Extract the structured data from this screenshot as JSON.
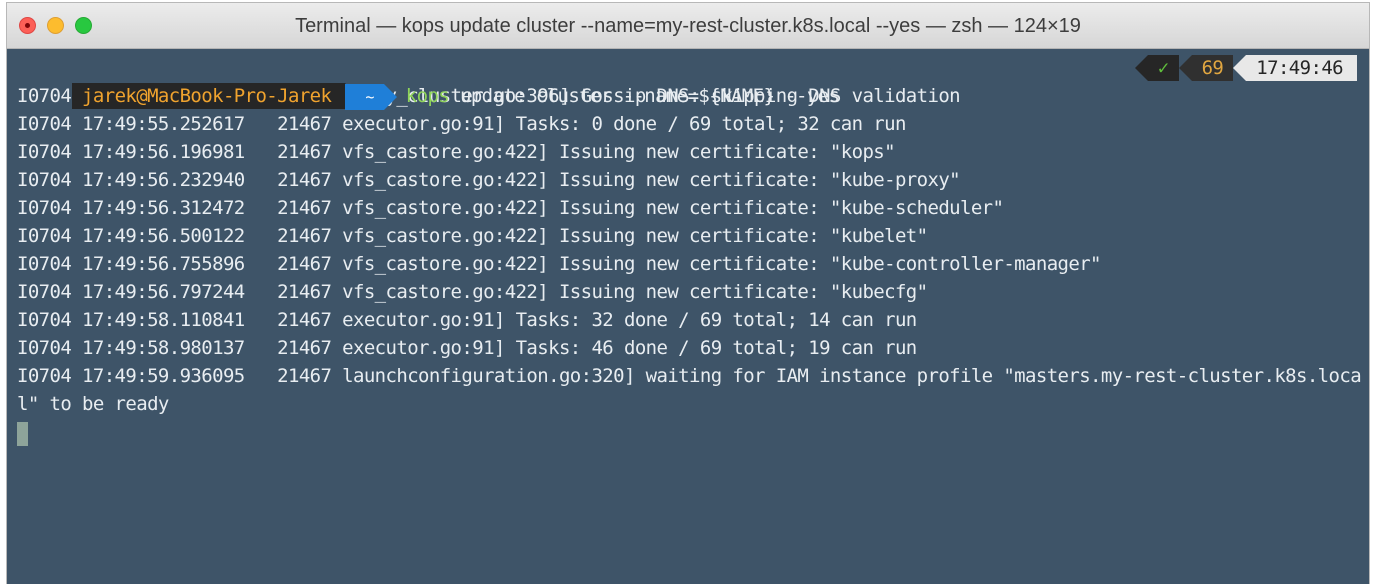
{
  "window": {
    "title": "Terminal — kops update cluster --name=my-rest-cluster.k8s.local --yes — zsh — 124×19"
  },
  "prompt": {
    "user_host": "jarek@MacBook-Pro-Jarek",
    "directory": "~",
    "command_name": "kops",
    "command_args": " update cluster --name=${NAME} --yes",
    "status_icon": "✓",
    "history_number": "69",
    "time": "17:49:46"
  },
  "output": [
    "I0704 17:49:54.732061   21467 apply_cluster.go:396] Gossip DNS: skipping DNS validation",
    "I0704 17:49:55.252617   21467 executor.go:91] Tasks: 0 done / 69 total; 32 can run",
    "I0704 17:49:56.196981   21467 vfs_castore.go:422] Issuing new certificate: \"kops\"",
    "I0704 17:49:56.232940   21467 vfs_castore.go:422] Issuing new certificate: \"kube-proxy\"",
    "I0704 17:49:56.312472   21467 vfs_castore.go:422] Issuing new certificate: \"kube-scheduler\"",
    "I0704 17:49:56.500122   21467 vfs_castore.go:422] Issuing new certificate: \"kubelet\"",
    "I0704 17:49:56.755896   21467 vfs_castore.go:422] Issuing new certificate: \"kube-controller-manager\"",
    "I0704 17:49:56.797244   21467 vfs_castore.go:422] Issuing new certificate: \"kubecfg\"",
    "I0704 17:49:58.110841   21467 executor.go:91] Tasks: 32 done / 69 total; 14 can run",
    "I0704 17:49:58.980137   21467 executor.go:91] Tasks: 46 done / 69 total; 19 can run",
    "I0704 17:49:59.936095   21467 launchconfiguration.go:320] waiting for IAM instance profile \"masters.my-rest-cluster.k8s.loca",
    "l\" to be ready"
  ]
}
